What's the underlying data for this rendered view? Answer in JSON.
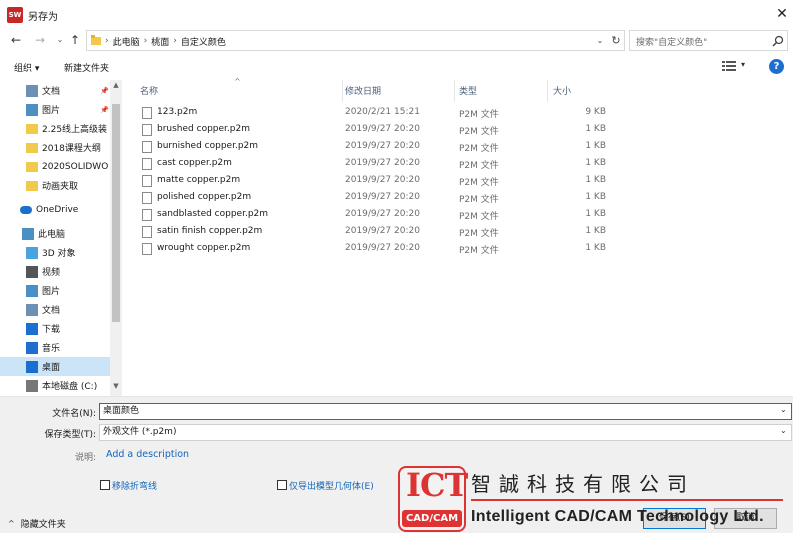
{
  "window": {
    "title": "另存为",
    "app_icon_text": "SW"
  },
  "address": {
    "crumbs": [
      "此电脑",
      "桃面",
      "自定义颜色"
    ],
    "search_placeholder": "搜索\"自定义颜色\""
  },
  "toolbar": {
    "organize_label": "组织 ▾",
    "new_folder_label": "新建文件夹",
    "help_label": "?"
  },
  "sidebar": {
    "items": [
      {
        "label": "文档",
        "icon": "document-icon",
        "pinned": true
      },
      {
        "label": "图片",
        "icon": "picture-icon",
        "pinned": true
      },
      {
        "label": "2.25线上高级装",
        "icon": "folder-icon",
        "pinned": false
      },
      {
        "label": "2018课程大纲",
        "icon": "folder-icon",
        "pinned": false
      },
      {
        "label": "2020SOLIDWO",
        "icon": "folder-icon",
        "pinned": false
      },
      {
        "label": "动画夹取",
        "icon": "folder-icon",
        "pinned": false
      },
      {
        "label": "OneDrive",
        "icon": "cloud-icon",
        "pinned": false
      },
      {
        "label": "此电脑",
        "icon": "computer-icon",
        "pinned": false
      },
      {
        "label": "3D 对象",
        "icon": "cube-icon",
        "pinned": false
      },
      {
        "label": "视频",
        "icon": "video-icon",
        "pinned": false
      },
      {
        "label": "图片",
        "icon": "picture-icon",
        "pinned": false
      },
      {
        "label": "文档",
        "icon": "document-icon",
        "pinned": false
      },
      {
        "label": "下载",
        "icon": "download-icon",
        "pinned": false
      },
      {
        "label": "音乐",
        "icon": "music-icon",
        "pinned": false
      },
      {
        "label": "桌面",
        "icon": "desktop-icon",
        "pinned": false,
        "selected": true
      },
      {
        "label": "本地磁盘 (C:)",
        "icon": "drive-icon",
        "pinned": false
      }
    ]
  },
  "columns": {
    "name": "名称",
    "date": "修改日期",
    "type": "类型",
    "size": "大小"
  },
  "files": [
    {
      "name": "123.p2m",
      "date": "2020/2/21 15:21",
      "type": "P2M 文件",
      "size": "9 KB"
    },
    {
      "name": "brushed copper.p2m",
      "date": "2019/9/27 20:20",
      "type": "P2M 文件",
      "size": "1 KB"
    },
    {
      "name": "burnished copper.p2m",
      "date": "2019/9/27 20:20",
      "type": "P2M 文件",
      "size": "1 KB"
    },
    {
      "name": "cast copper.p2m",
      "date": "2019/9/27 20:20",
      "type": "P2M 文件",
      "size": "1 KB"
    },
    {
      "name": "matte copper.p2m",
      "date": "2019/9/27 20:20",
      "type": "P2M 文件",
      "size": "1 KB"
    },
    {
      "name": "polished copper.p2m",
      "date": "2019/9/27 20:20",
      "type": "P2M 文件",
      "size": "1 KB"
    },
    {
      "name": "sandblasted copper.p2m",
      "date": "2019/9/27 20:20",
      "type": "P2M 文件",
      "size": "1 KB"
    },
    {
      "name": "satin finish copper.p2m",
      "date": "2019/9/27 20:20",
      "type": "P2M 文件",
      "size": "1 KB"
    },
    {
      "name": "wrought copper.p2m",
      "date": "2019/9/27 20:20",
      "type": "P2M 文件",
      "size": "1 KB"
    }
  ],
  "form": {
    "filename_label": "文件名(N):",
    "filename_value": "桌面颜色",
    "filetype_label": "保存类型(T):",
    "filetype_value": "外观文件 (*.p2m)",
    "description_label": "说明:",
    "description_link": "Add a description",
    "checkbox1_label": "移除折弯线",
    "checkbox2_label": "仅导出模型几何体(E)",
    "hide_folders_label": "隐藏文件夹",
    "save_label": "保存(S)",
    "cancel_label": "取消"
  },
  "watermark": {
    "logo_text": "ICT",
    "logo_sub": "CAD/CAM",
    "company_cn": "智誠科技有限公司",
    "company_en": "Intelligent CAD/CAM Technology Ltd."
  },
  "colors": {
    "accent": "#0078d7",
    "selection": "#cce4f7",
    "link": "#1465b8",
    "watermark_red": "#dd3333"
  }
}
